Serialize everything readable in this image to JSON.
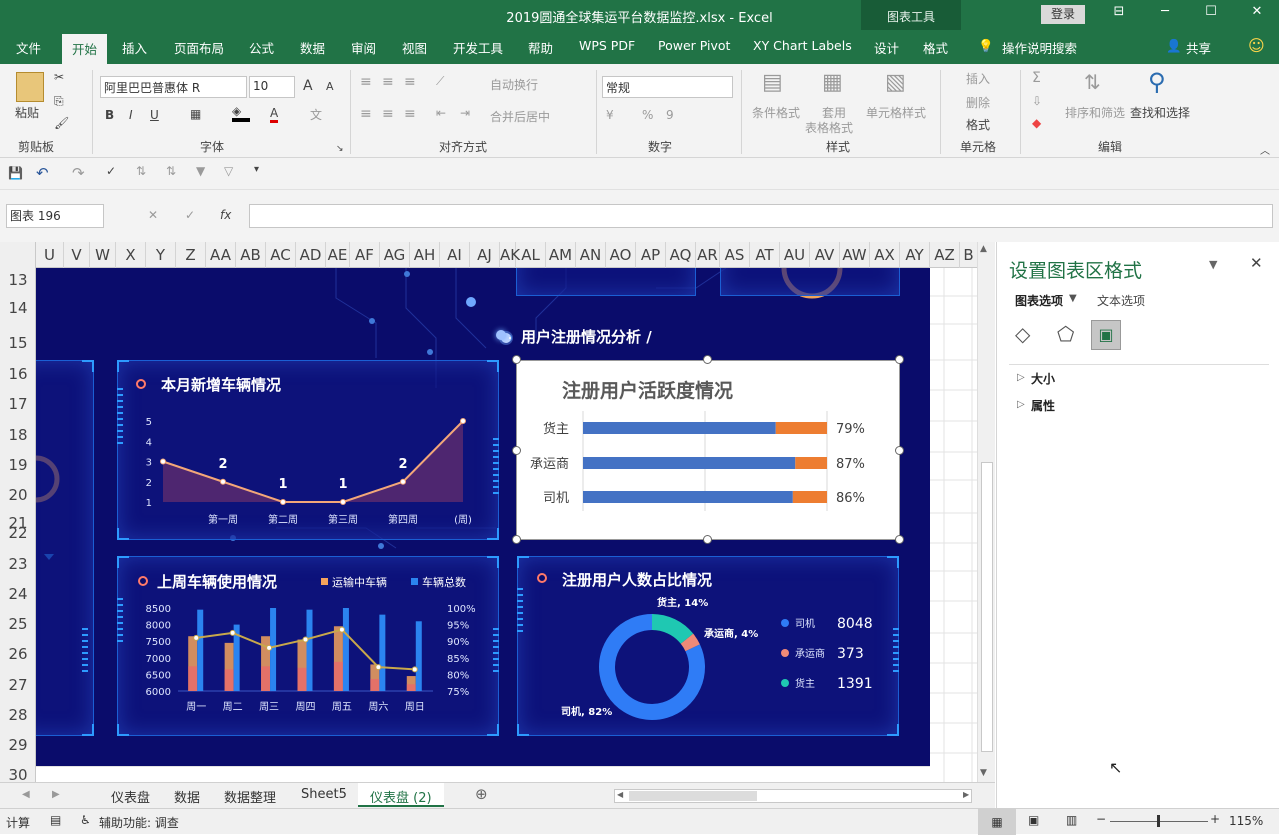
{
  "window": {
    "title": "2019圆通全球集运平台数据监控.xlsx - Excel",
    "context_tab": "图表工具",
    "login": "登录",
    "controls": {
      "ribbon_display": "⊟",
      "minimize": "─",
      "maximize": "☐",
      "close": "✕"
    }
  },
  "tabs": [
    "文件",
    "开始",
    "插入",
    "页面布局",
    "公式",
    "数据",
    "审阅",
    "视图",
    "开发工具",
    "帮助",
    "WPS PDF",
    "Power Pivot",
    "XY Chart Labels",
    "设计",
    "格式"
  ],
  "tell_me": "操作说明搜索",
  "share": "共享",
  "ribbon": {
    "clipboard": {
      "group": "剪贴板",
      "paste": "粘贴"
    },
    "font": {
      "group": "字体",
      "font_name": "阿里巴巴普惠体 R",
      "font_size": "10",
      "bold": "B",
      "italic": "I",
      "underline": "U",
      "grow": "A",
      "shrink": "A"
    },
    "align": {
      "group": "对齐方式",
      "wrap": "自动换行",
      "merge": "合并后居中"
    },
    "number": {
      "group": "数字",
      "format": "常规",
      "percent": "%",
      "comma": "9"
    },
    "styles": {
      "group": "样式",
      "conditional": "条件格式",
      "table_l1": "套用",
      "table_l2": "表格格式",
      "cell_styles": "单元格样式"
    },
    "cells": {
      "group": "单元格",
      "insert": "插入",
      "delete": "删除",
      "format": "格式"
    },
    "editing": {
      "group": "编辑",
      "sort": "排序和筛选",
      "find": "查找和选择"
    }
  },
  "formula_bar": {
    "name_box": "图表 196",
    "fx": "fx",
    "cancel": "✕",
    "enter": "✓",
    "value": ""
  },
  "columns": [
    "U",
    "V",
    "W",
    "X",
    "Y",
    "Z",
    "AA",
    "AB",
    "AC",
    "AD",
    "AE",
    "AF",
    "AG",
    "AH",
    "AI",
    "AJ",
    "AK",
    "AL",
    "AM",
    "AN",
    "AO",
    "AP",
    "AQ",
    "AR",
    "AS",
    "AT",
    "AU",
    "AV",
    "AW",
    "AX",
    "AY",
    "AZ",
    "B"
  ],
  "rows": [
    "13",
    "14",
    "15",
    "16",
    "17",
    "18",
    "19",
    "20",
    "21",
    "22",
    "23",
    "24",
    "25",
    "26",
    "27",
    "28",
    "29",
    "30"
  ],
  "dashboard": {
    "section_label": "用户注册情况分析 /",
    "panel1": {
      "title": "本月新增车辆情况"
    },
    "panel2": {
      "title": "上周车辆使用情况"
    },
    "panel3": {
      "title": "注册用户人数占比情况"
    }
  },
  "chart_data": [
    {
      "type": "area",
      "title": "本月新增车辆情况",
      "categories": [
        "",
        "第一周",
        "第二周",
        "第三周",
        "第四周",
        "(周)"
      ],
      "values": [
        3,
        2,
        1,
        1,
        2,
        5
      ],
      "data_labels": [
        "",
        "2",
        "1",
        "1",
        "2",
        ""
      ],
      "ylim": [
        1,
        5
      ],
      "yticks": [
        "5",
        "4",
        "3",
        "2",
        "1"
      ],
      "colors": {
        "line": "#f3a779",
        "fill": "#5a2a6e"
      }
    },
    {
      "type": "bar",
      "title": "上周车辆使用情况",
      "categories": [
        "周一",
        "周二",
        "周三",
        "周四",
        "周五",
        "周六",
        "周日"
      ],
      "series": [
        {
          "name": "运输中车辆",
          "values": [
            7650,
            7450,
            7650,
            7550,
            7950,
            6800,
            6450
          ],
          "color": "#f5a35c"
        },
        {
          "name": "车辆总数",
          "values": [
            8450,
            8000,
            8500,
            8450,
            8500,
            8300,
            8100
          ],
          "color": "#2b84f0"
        },
        {
          "name": "",
          "values": [
            0.91,
            0.925,
            0.88,
            0.905,
            0.935,
            0.822,
            0.815
          ],
          "color": "#c8a84b",
          "axis": "right"
        }
      ],
      "ylim": [
        6000,
        8500
      ],
      "yticks_left": [
        "8500",
        "8000",
        "7500",
        "7000",
        "6500",
        "6000"
      ],
      "yticks_right": [
        "100%",
        "95%",
        "90%",
        "85%",
        "80%",
        "75%"
      ],
      "ylim_right": [
        0.75,
        1.0
      ]
    },
    {
      "type": "bar",
      "title": "注册用户活跃度情况",
      "categories": [
        "货主",
        "承运商",
        "司机"
      ],
      "values": [
        0.79,
        0.87,
        0.86
      ],
      "labels": [
        "79%",
        "87%",
        "86%"
      ],
      "colors": {
        "active": "#4472c4",
        "rest": "#ed7d31"
      }
    },
    {
      "type": "pie",
      "title": "注册用户人数占比情况",
      "slices": [
        {
          "label": "司机",
          "value": 8048,
          "data_label": "司机, 82%",
          "color": "#2f7cf6"
        },
        {
          "label": "承运商",
          "value": 373,
          "data_label": "承运商, 4%",
          "color": "#f08a78"
        },
        {
          "label": "货主",
          "value": 1391,
          "data_label": "货主, 14%",
          "color": "#1fc8b2"
        }
      ],
      "legend": [
        {
          "label": "司机",
          "value": "8048"
        },
        {
          "label": "承运商",
          "value": "373"
        },
        {
          "label": "货主",
          "value": "1391"
        }
      ]
    }
  ],
  "format_pane": {
    "title": "设置图表区格式",
    "tab_chart": "图表选项",
    "tab_text": "文本选项",
    "sections": [
      "大小",
      "属性"
    ]
  },
  "sheets": [
    "仪表盘",
    "数据",
    "数据整理",
    "Sheet5",
    "仪表盘 (2)"
  ],
  "active_sheet": "仪表盘 (2)",
  "status": {
    "mode": "计算",
    "accessibility": "辅助功能: 调查",
    "zoom": "115%"
  }
}
